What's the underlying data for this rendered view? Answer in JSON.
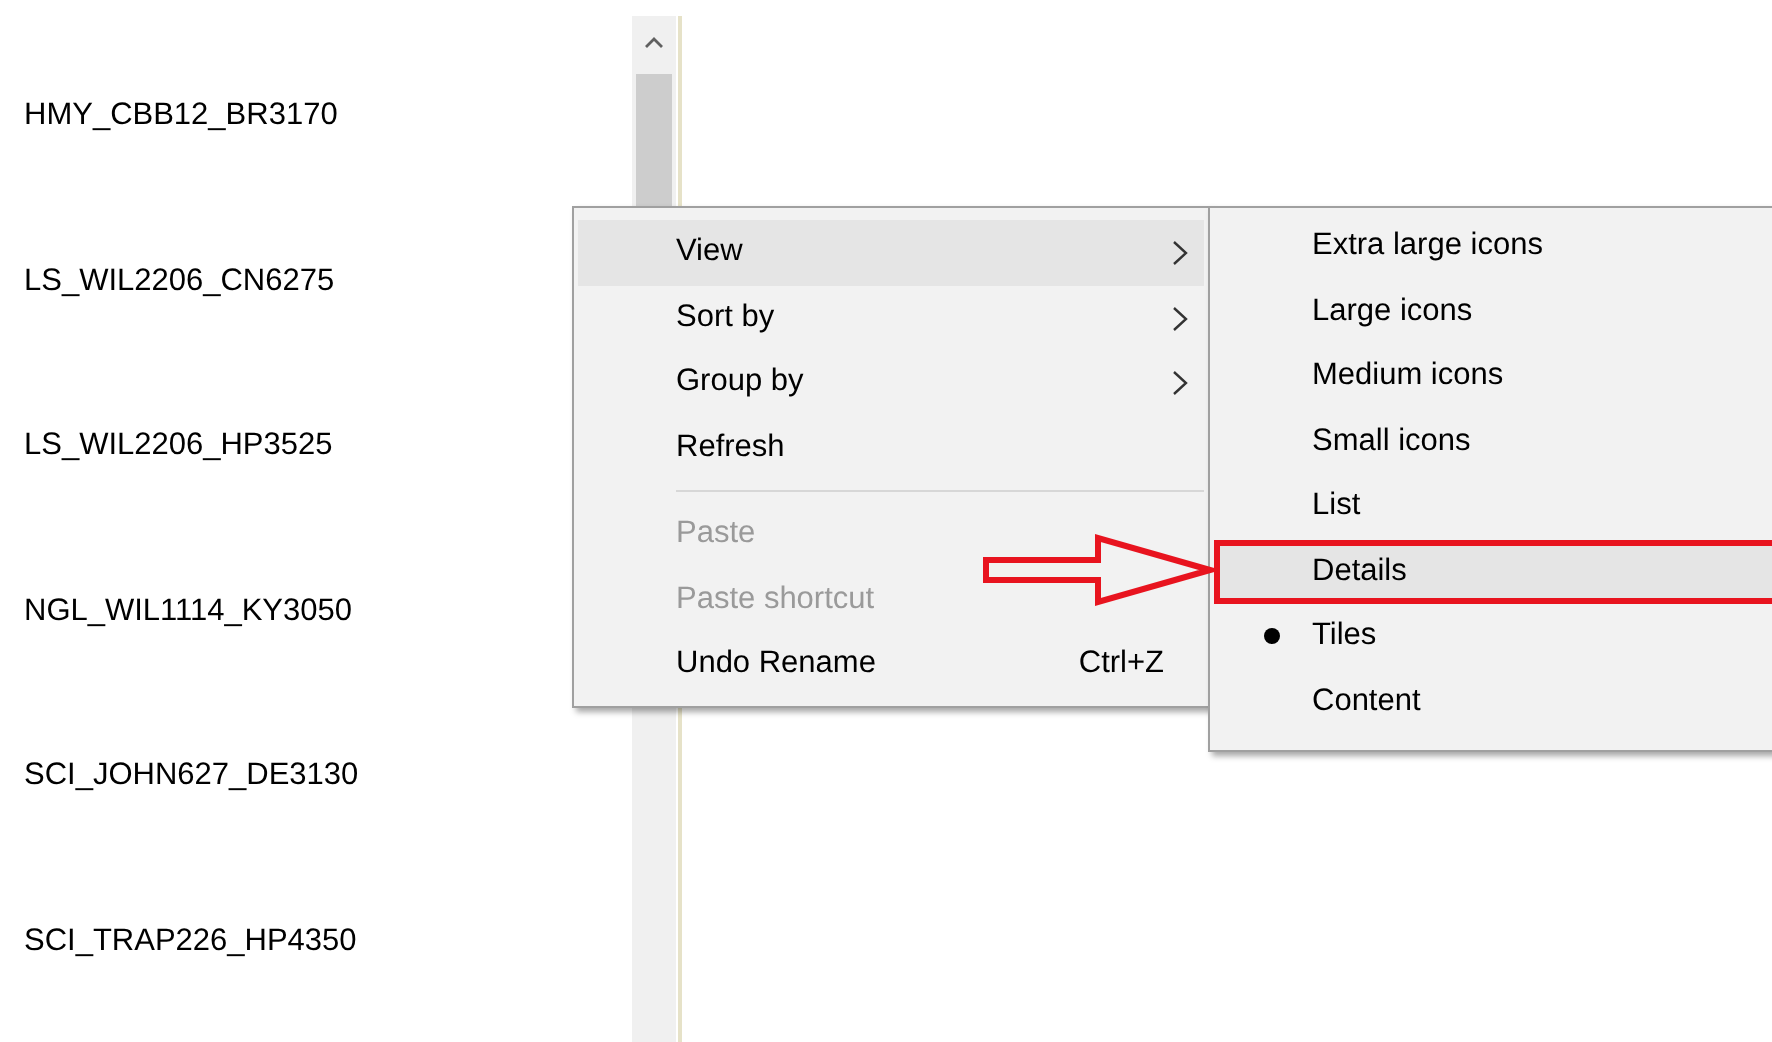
{
  "files": [
    "HMY_CBB12_BR3170",
    "LS_WIL2206_CN6275",
    "LS_WIL2206_HP3525",
    "NGL_WIL1114_KY3050",
    "SCI_JOHN627_DE3130",
    "SCI_TRAP226_HP4350"
  ],
  "context_menu": {
    "items": [
      {
        "kind": "item",
        "label": "View",
        "submenu": true,
        "highlighted": true,
        "disabled": false
      },
      {
        "kind": "item",
        "label": "Sort by",
        "submenu": true,
        "highlighted": false,
        "disabled": false
      },
      {
        "kind": "item",
        "label": "Group by",
        "submenu": true,
        "highlighted": false,
        "disabled": false
      },
      {
        "kind": "item",
        "label": "Refresh",
        "submenu": false,
        "highlighted": false,
        "disabled": false
      },
      {
        "kind": "separator"
      },
      {
        "kind": "item",
        "label": "Paste",
        "submenu": false,
        "highlighted": false,
        "disabled": true
      },
      {
        "kind": "item",
        "label": "Paste shortcut",
        "submenu": false,
        "highlighted": false,
        "disabled": true
      },
      {
        "kind": "item",
        "label": "Undo Rename",
        "shortcut": "Ctrl+Z",
        "submenu": false,
        "highlighted": false,
        "disabled": false
      }
    ]
  },
  "view_submenu": {
    "items": [
      {
        "label": "Extra large icons",
        "selected": false,
        "highlighted": false,
        "annotated": false
      },
      {
        "label": "Large icons",
        "selected": false,
        "highlighted": false,
        "annotated": false
      },
      {
        "label": "Medium icons",
        "selected": false,
        "highlighted": false,
        "annotated": false
      },
      {
        "label": "Small icons",
        "selected": false,
        "highlighted": false,
        "annotated": false
      },
      {
        "label": "List",
        "selected": false,
        "highlighted": false,
        "annotated": false
      },
      {
        "label": "Details",
        "selected": false,
        "highlighted": true,
        "annotated": true
      },
      {
        "label": "Tiles",
        "selected": true,
        "highlighted": false,
        "annotated": false
      },
      {
        "label": "Content",
        "selected": false,
        "highlighted": false,
        "annotated": false
      }
    ]
  }
}
